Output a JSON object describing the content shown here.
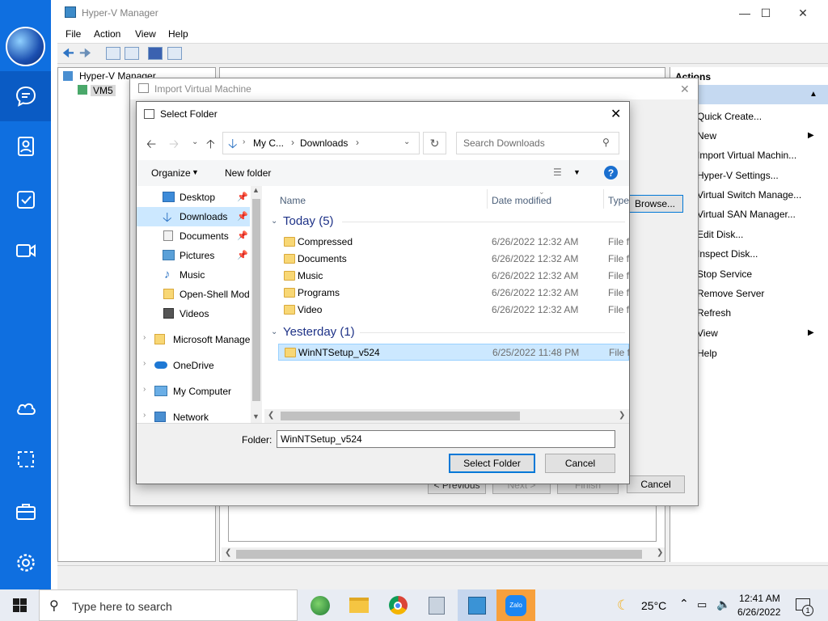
{
  "hyperv": {
    "title": "Hyper-V Manager",
    "menu": [
      "File",
      "Action",
      "View",
      "Help"
    ],
    "tree_root": "Hyper-V Manager",
    "tree_child": "VM5",
    "actions_header": "Actions",
    "actions": [
      "Quick Create...",
      "New",
      "Import Virtual Machin...",
      "Hyper-V Settings...",
      "Virtual Switch Manage...",
      "Virtual SAN Manager...",
      "Edit Disk...",
      "Inspect Disk...",
      "Stop Service",
      "Remove Server",
      "Refresh",
      "View",
      "Help"
    ]
  },
  "import_dialog": {
    "title": "Import Virtual Machine",
    "browse": "Browse...",
    "previous": "< Previous",
    "next": "Next >",
    "finish": "Finish",
    "cancel": "Cancel"
  },
  "select_folder": {
    "title": "Select Folder",
    "breadcrumb": [
      "My C...",
      "Downloads"
    ],
    "search_placeholder": "Search Downloads",
    "organize": "Organize",
    "new_folder": "New folder",
    "nav": [
      {
        "label": "Desktop",
        "icon": "desktop-icon"
      },
      {
        "label": "Downloads",
        "icon": "download-icon"
      },
      {
        "label": "Documents",
        "icon": "documents-icon"
      },
      {
        "label": "Pictures",
        "icon": "pictures-icon"
      },
      {
        "label": "Music",
        "icon": "music-icon"
      },
      {
        "label": "Open-Shell Mod",
        "icon": "folder-icon"
      },
      {
        "label": "Videos",
        "icon": "videos-icon"
      },
      {
        "label": "Microsoft Manage",
        "icon": "folder-icon"
      },
      {
        "label": "OneDrive",
        "icon": "cloud-icon"
      },
      {
        "label": "My Computer",
        "icon": "computer-icon"
      },
      {
        "label": "Network",
        "icon": "network-icon"
      }
    ],
    "columns": {
      "name": "Name",
      "date": "Date modified",
      "type": "Type"
    },
    "groups": [
      {
        "label": "Today (5)",
        "items": [
          {
            "name": "Compressed",
            "date": "6/26/2022 12:32 AM",
            "type": "File fo"
          },
          {
            "name": "Documents",
            "date": "6/26/2022 12:32 AM",
            "type": "File fo"
          },
          {
            "name": "Music",
            "date": "6/26/2022 12:32 AM",
            "type": "File fo"
          },
          {
            "name": "Programs",
            "date": "6/26/2022 12:32 AM",
            "type": "File fo"
          },
          {
            "name": "Video",
            "date": "6/26/2022 12:32 AM",
            "type": "File fo"
          }
        ]
      },
      {
        "label": "Yesterday (1)",
        "items": [
          {
            "name": "WinNTSetup_v524",
            "date": "6/25/2022 11:48 PM",
            "type": "File fo"
          }
        ]
      }
    ],
    "folder_label": "Folder:",
    "folder_value": "WinNTSetup_v524",
    "select_btn": "Select Folder",
    "cancel_btn": "Cancel"
  },
  "taskbar": {
    "search_placeholder": "Type here to search",
    "temperature": "25°C",
    "time": "12:41 AM",
    "date": "6/26/2022",
    "notification_count": "1"
  },
  "colors": {
    "sidebar": "#0f6fe0",
    "selection": "#cce8ff",
    "accent": "#0078d7"
  }
}
